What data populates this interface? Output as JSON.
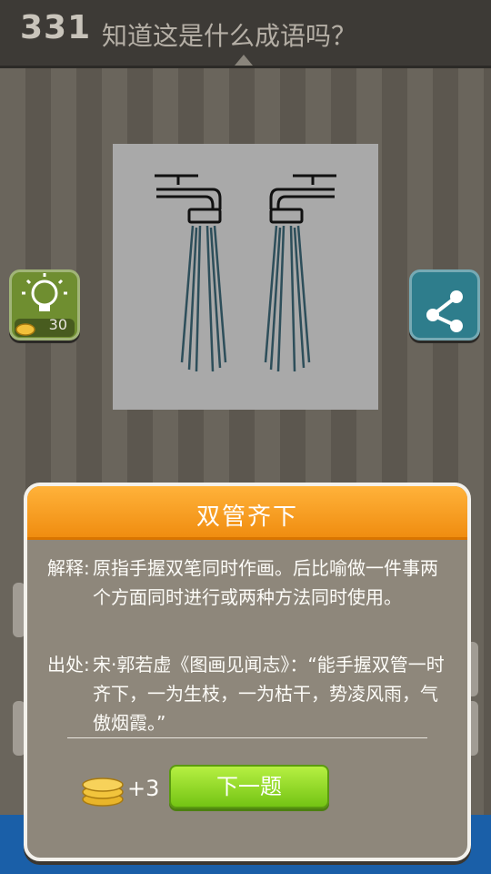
{
  "header": {
    "level": "331",
    "question": "知道这是什么成语吗？"
  },
  "puzzle": {
    "image": "two-water-taps-picture"
  },
  "hint": {
    "icon": "lightbulb-icon",
    "coin_icon": "coin-icon",
    "cost": "30"
  },
  "share": {
    "icon": "share-icon"
  },
  "modal": {
    "title": "双管齐下",
    "explanation_label": "解释:",
    "explanation_text": "原指手握双笔同时作画。后比喻做一件事两个方面同时进行或两种方法同时使用。",
    "source_label": "出处:",
    "source_text": "宋·郭若虚《图画见闻志》：“能手握双管一时齐下，一为生枝，一为枯干，势凌风雨，气傲烟霞。”",
    "reward": "+3",
    "next_label": "下一题"
  },
  "colors": {
    "accent": "#f5a21f",
    "next_button": "#8fd82a",
    "hint": "#6f8e30",
    "share": "#2e7d8c"
  }
}
